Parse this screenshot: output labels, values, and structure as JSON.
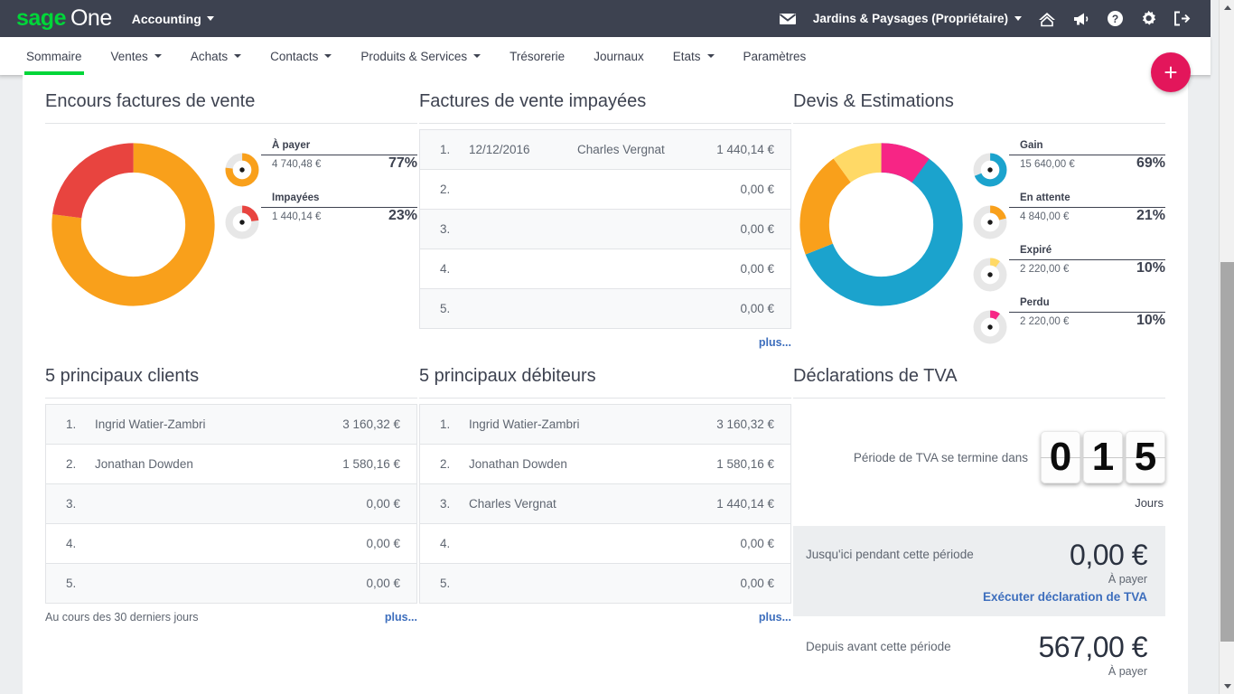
{
  "brand": {
    "logo_sage": "sage",
    "logo_one": "One",
    "product": "Accounting",
    "accent_green": "#00d639",
    "topbar_bg": "#3d4250",
    "fab_color": "#e3165b",
    "link_color": "#3d6ebd"
  },
  "header": {
    "company": "Jardins & Paysages (Propriétaire)",
    "icons": [
      "envelope-icon",
      "home-icon",
      "megaphone-icon",
      "help-icon",
      "gear-icon",
      "logout-icon"
    ]
  },
  "nav": {
    "items": [
      {
        "label": "Sommaire",
        "has_caret": false,
        "active": true
      },
      {
        "label": "Ventes",
        "has_caret": true,
        "active": false
      },
      {
        "label": "Achats",
        "has_caret": true,
        "active": false
      },
      {
        "label": "Contacts",
        "has_caret": true,
        "active": false
      },
      {
        "label": "Produits & Services",
        "has_caret": true,
        "active": false
      },
      {
        "label": "Trésorerie",
        "has_caret": false,
        "active": false
      },
      {
        "label": "Journaux",
        "has_caret": false,
        "active": false
      },
      {
        "label": "Etats",
        "has_caret": true,
        "active": false
      },
      {
        "label": "Paramètres",
        "has_caret": false,
        "active": false
      }
    ]
  },
  "fab": {
    "label": "+"
  },
  "cards": {
    "outstanding_invoices": {
      "title": "Encours factures de vente",
      "legend": [
        {
          "label": "À payer",
          "amount": "4 740,48 €",
          "percent": "77%",
          "color": "#f9a01b"
        },
        {
          "label": "Impayées",
          "amount": "1 440,14 €",
          "percent": "23%",
          "color": "#e8443f"
        }
      ]
    },
    "unpaid_invoices": {
      "title": "Factures de vente impayées",
      "rows": [
        {
          "num": "1.",
          "date": "12/12/2016",
          "name": "Charles Vergnat",
          "amount": "1 440,14 €"
        },
        {
          "num": "2.",
          "date": "",
          "name": "",
          "amount": "0,00 €"
        },
        {
          "num": "3.",
          "date": "",
          "name": "",
          "amount": "0,00 €"
        },
        {
          "num": "4.",
          "date": "",
          "name": "",
          "amount": "0,00 €"
        },
        {
          "num": "5.",
          "date": "",
          "name": "",
          "amount": "0,00 €"
        }
      ],
      "more": "plus..."
    },
    "quotes_estimates": {
      "title": "Devis & Estimations",
      "legend": [
        {
          "label": "Gain",
          "amount": "15 640,00 €",
          "percent": "69%",
          "color": "#1ba3cd"
        },
        {
          "label": "En attente",
          "amount": "4 840,00 €",
          "percent": "21%",
          "color": "#f9a01b"
        },
        {
          "label": "Expiré",
          "amount": "2 220,00 €",
          "percent": "10%",
          "color": "#ffd966"
        },
        {
          "label": "Perdu",
          "amount": "2 220,00 €",
          "percent": "10%",
          "color": "#f72585"
        }
      ]
    },
    "top_clients": {
      "title": "5 principaux clients",
      "rows": [
        {
          "num": "1.",
          "name": "Ingrid Watier-Zambri",
          "amount": "3 160,32 €"
        },
        {
          "num": "2.",
          "name": "Jonathan Dowden",
          "amount": "1 580,16 €"
        },
        {
          "num": "3.",
          "name": "",
          "amount": "0,00 €"
        },
        {
          "num": "4.",
          "name": "",
          "amount": "0,00 €"
        },
        {
          "num": "5.",
          "name": "",
          "amount": "0,00 €"
        }
      ],
      "footnote": "Au cours des 30 derniers jours",
      "more": "plus..."
    },
    "top_debtors": {
      "title": "5 principaux débiteurs",
      "rows": [
        {
          "num": "1.",
          "name": "Ingrid Watier-Zambri",
          "amount": "3 160,32 €"
        },
        {
          "num": "2.",
          "name": "Jonathan Dowden",
          "amount": "1 580,16 €"
        },
        {
          "num": "3.",
          "name": "Charles Vergnat",
          "amount": "1 440,14 €"
        },
        {
          "num": "4.",
          "name": "",
          "amount": "0,00 €"
        },
        {
          "num": "5.",
          "name": "",
          "amount": "0,00 €"
        }
      ],
      "more": "plus..."
    },
    "vat_returns": {
      "title": "Déclarations de TVA",
      "countdown_label": "Période de TVA se termine dans",
      "countdown_digits": [
        "0",
        "1",
        "5"
      ],
      "countdown_unit": "Jours",
      "current_period_label": "Jusqu'ici pendant cette période",
      "current_period_amount": "0,00 €",
      "current_period_sub": "À payer",
      "run_link": "Exécuter déclaration de TVA",
      "previous_period_label": "Depuis avant cette période",
      "previous_period_amount": "567,00 €",
      "previous_period_sub": "À payer"
    }
  },
  "chart_data": [
    {
      "type": "pie",
      "title": "Encours factures de vente",
      "categories": [
        "À payer",
        "Impayées"
      ],
      "values": [
        4740.48,
        1440.14
      ],
      "percents": [
        77,
        23
      ],
      "colors": [
        "#f9a01b",
        "#e8443f"
      ],
      "legend_position": "right",
      "unit": "€"
    },
    {
      "type": "pie",
      "title": "Devis & Estimations",
      "categories": [
        "Gain",
        "En attente",
        "Expiré",
        "Perdu"
      ],
      "values": [
        15640.0,
        4840.0,
        2220.0,
        2220.0
      ],
      "percents": [
        69,
        21,
        10,
        10
      ],
      "colors": [
        "#1ba3cd",
        "#f9a01b",
        "#ffd966",
        "#f72585"
      ],
      "legend_position": "right",
      "unit": "€"
    }
  ]
}
